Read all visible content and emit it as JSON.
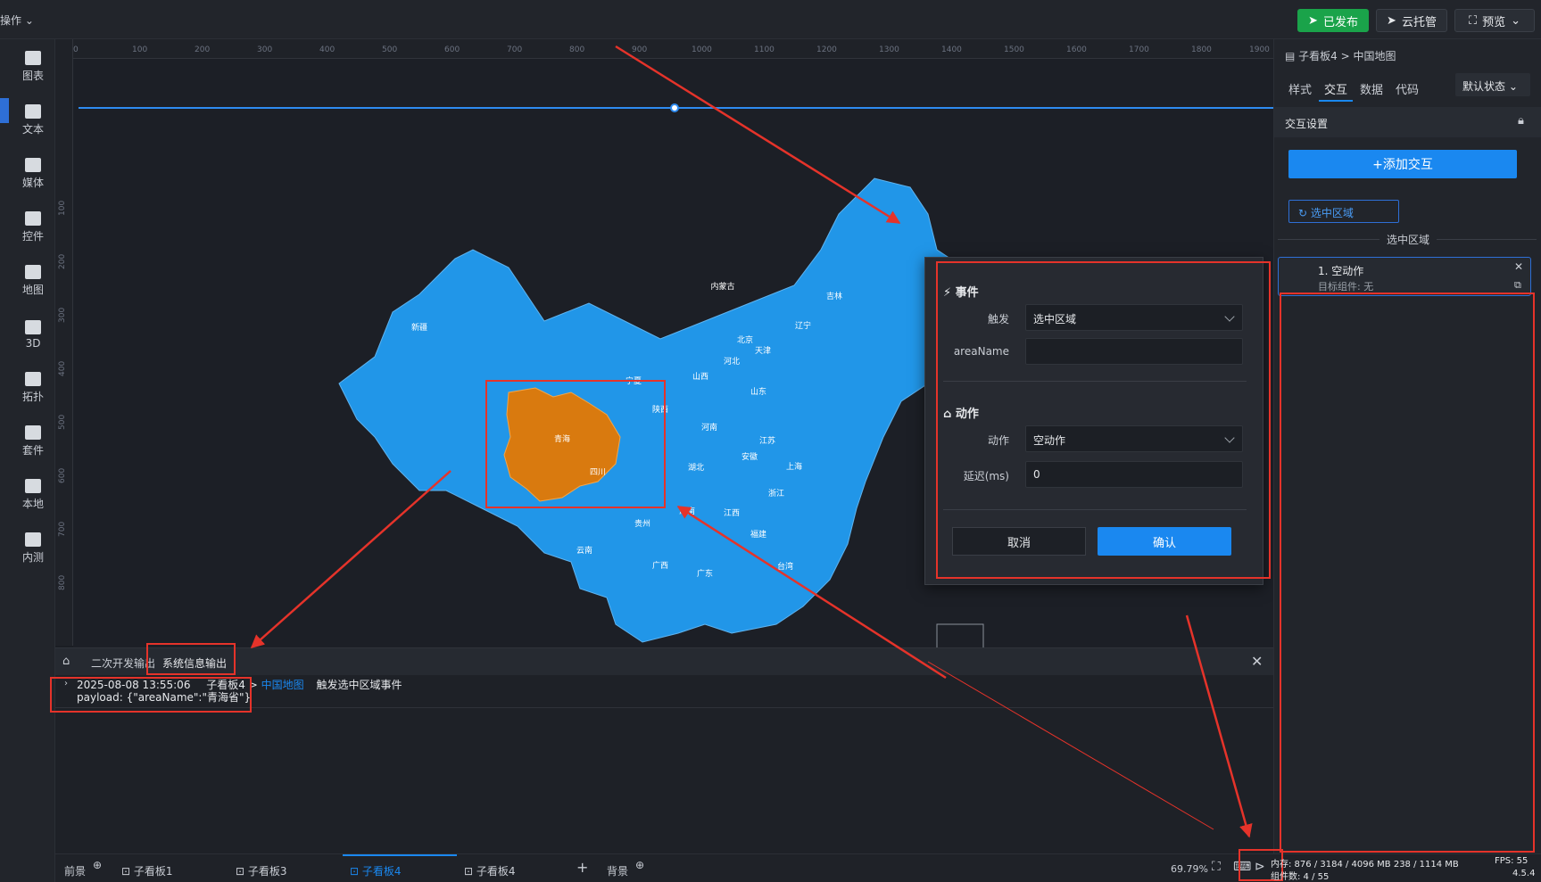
{
  "topbar": {
    "ops_label": "操作",
    "publish_label": "已发布",
    "cloud_label": "云托管",
    "preview_label": "预览"
  },
  "sidebar": {
    "items": [
      "图表",
      "文本",
      "媒体",
      "控件",
      "地图",
      "3D",
      "拓扑",
      "套件",
      "本地",
      "内测"
    ]
  },
  "ruler": {
    "top_ticks": [
      "0",
      "100",
      "200",
      "300",
      "400",
      "500",
      "600",
      "700",
      "800",
      "900",
      "1000",
      "1100",
      "1200",
      "1300",
      "1400",
      "1500",
      "1600",
      "1700",
      "1800",
      "1900"
    ],
    "left_ticks": [
      "100",
      "200",
      "300",
      "400",
      "500",
      "600",
      "700",
      "800"
    ]
  },
  "map": {
    "provinces": [
      "新疆",
      "内蒙古",
      "青海",
      "宁夏",
      "山西",
      "北京",
      "天津",
      "河北",
      "山东",
      "辽宁",
      "吉林",
      "陕西",
      "河南",
      "江苏",
      "安徽",
      "上海",
      "湖北",
      "四川",
      "浙江",
      "湖南",
      "江西",
      "贵州",
      "福建",
      "云南",
      "广西",
      "广东",
      "台湾"
    ],
    "selected": "青海",
    "base_color": "#2196e8",
    "selected_color": "#d97a0f"
  },
  "dialog": {
    "event_title": "事件",
    "trigger_label": "触发",
    "trigger_value": "选中区域",
    "areaname_label": "areaName",
    "areaname_value": "",
    "action_title": "动作",
    "action_label": "动作",
    "action_value": "空动作",
    "delay_label": "延迟(ms)",
    "delay_value": "0",
    "cancel_label": "取消",
    "confirm_label": "确认"
  },
  "rpanel": {
    "breadcrumb_parent": "子看板4",
    "breadcrumb_sep": ">",
    "breadcrumb_current": "中国地图",
    "tabs": [
      "样式",
      "交互",
      "数据",
      "代码"
    ],
    "active_tab": "交互",
    "state_select": "默认状态",
    "section_title": "交互设置",
    "add_button": "+添加交互",
    "chip_label": "选中区域",
    "divider_label": "选中区域",
    "item_title": "1. 空动作",
    "item_sub": "目标组件: 无"
  },
  "console": {
    "tab_dev": "二次开发输出",
    "tab_sys": "系统信息输出",
    "log_time": "2025-08-08 13:55:06",
    "log_source": "子看板4 >",
    "log_component": "中国地图",
    "log_event": "触发选中区域事件",
    "log_payload": "payload: {\"areaName\":\"青海省\"}"
  },
  "bottombar": {
    "tabs": [
      "前景",
      "子看板1",
      "子看板3",
      "子看板4",
      "子看板4",
      "背景"
    ],
    "active_tab": "子看板4",
    "zoom": "69.79%",
    "memory": "内存: 876 / 3184 / 4096 MB 238 / 1114 MB",
    "components": "组件数: 4 / 55",
    "fps": "FPS: 55",
    "version": "4.5.4"
  },
  "colors": {
    "accent": "#1a88f0",
    "publish_green": "#1aa34a",
    "annotation_red": "#e5332a"
  }
}
